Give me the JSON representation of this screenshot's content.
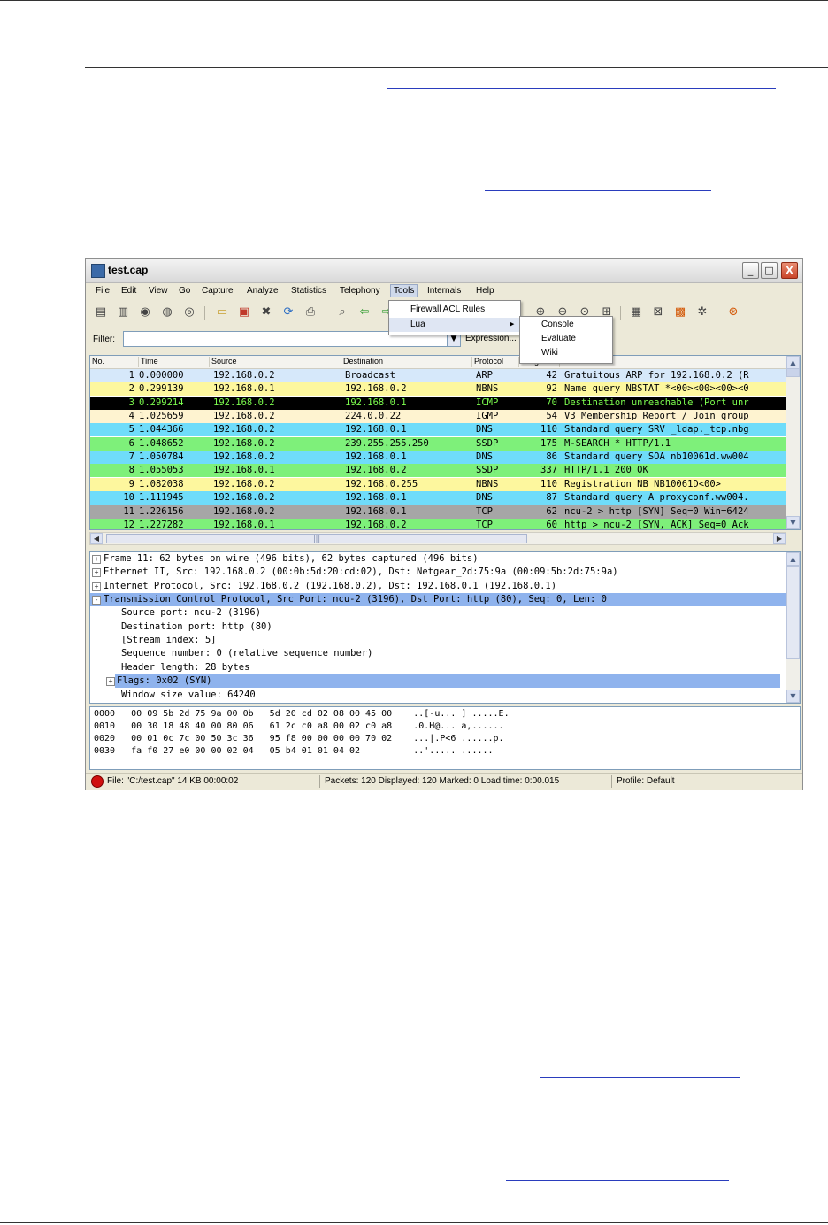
{
  "window": {
    "title": "test.cap",
    "minimize": "_",
    "maximize": "□",
    "close": "X"
  },
  "menubar": [
    "File",
    "Edit",
    "View",
    "Go",
    "Capture",
    "Analyze",
    "Statistics",
    "Telephony",
    "Tools",
    "Internals",
    "Help"
  ],
  "tools_menu": [
    "Firewall ACL Rules",
    "Lua"
  ],
  "lua_submenu": [
    "Console",
    "Evaluate",
    "Wiki"
  ],
  "filter": {
    "label": "Filter:",
    "value": "",
    "expression_button": "Expression..."
  },
  "packet_list": {
    "columns": [
      "No.",
      "Time",
      "Source",
      "Destination",
      "Protocol",
      "Length",
      "Info"
    ],
    "rows": [
      {
        "no": "1",
        "time": "0.000000",
        "src": "192.168.0.2",
        "dst": "Broadcast",
        "proto": "ARP",
        "len": "42",
        "info": "Gratuitous ARP for 192.168.0.2 (R",
        "bg": "#d6e8fa",
        "fg": "#000000"
      },
      {
        "no": "2",
        "time": "0.299139",
        "src": "192.168.0.1",
        "dst": "192.168.0.2",
        "proto": "NBNS",
        "len": "92",
        "info": "Name query NBSTAT *<00><00><00><0",
        "bg": "#fdf79e",
        "fg": "#000000"
      },
      {
        "no": "3",
        "time": "0.299214",
        "src": "192.168.0.2",
        "dst": "192.168.0.1",
        "proto": "ICMP",
        "len": "70",
        "info": "Destination unreachable (Port unr",
        "bg": "#000000",
        "fg": "#7cfc4e"
      },
      {
        "no": "4",
        "time": "1.025659",
        "src": "192.168.0.2",
        "dst": "224.0.0.22",
        "proto": "IGMP",
        "len": "54",
        "info": "V3 Membership Report / Join group",
        "bg": "#fef3d0",
        "fg": "#000000"
      },
      {
        "no": "5",
        "time": "1.044366",
        "src": "192.168.0.2",
        "dst": "192.168.0.1",
        "proto": "DNS",
        "len": "110",
        "info": "Standard query SRV _ldap._tcp.nbg",
        "bg": "#6fdcfa",
        "fg": "#000000"
      },
      {
        "no": "6",
        "time": "1.048652",
        "src": "192.168.0.2",
        "dst": "239.255.255.250",
        "proto": "SSDP",
        "len": "175",
        "info": "M-SEARCH * HTTP/1.1",
        "bg": "#7ef07a",
        "fg": "#000000"
      },
      {
        "no": "7",
        "time": "1.050784",
        "src": "192.168.0.2",
        "dst": "192.168.0.1",
        "proto": "DNS",
        "len": "86",
        "info": "Standard query SOA nb10061d.ww004",
        "bg": "#6fdcfa",
        "fg": "#000000"
      },
      {
        "no": "8",
        "time": "1.055053",
        "src": "192.168.0.1",
        "dst": "192.168.0.2",
        "proto": "SSDP",
        "len": "337",
        "info": "HTTP/1.1 200 OK",
        "bg": "#7ef07a",
        "fg": "#000000"
      },
      {
        "no": "9",
        "time": "1.082038",
        "src": "192.168.0.2",
        "dst": "192.168.0.255",
        "proto": "NBNS",
        "len": "110",
        "info": "Registration NB NB10061D<00>",
        "bg": "#fdf79e",
        "fg": "#000000"
      },
      {
        "no": "10",
        "time": "1.111945",
        "src": "192.168.0.2",
        "dst": "192.168.0.1",
        "proto": "DNS",
        "len": "87",
        "info": "Standard query A proxyconf.ww004.",
        "bg": "#6fdcfa",
        "fg": "#000000"
      },
      {
        "no": "11",
        "time": "1.226156",
        "src": "192.168.0.2",
        "dst": "192.168.0.1",
        "proto": "TCP",
        "len": "62",
        "info": "ncu-2 > http [SYN] Seq=0 Win=6424",
        "bg": "#a6a6a6",
        "fg": "#000000"
      },
      {
        "no": "12",
        "time": "1.227282",
        "src": "192.168.0.1",
        "dst": "192.168.0.2",
        "proto": "TCP",
        "len": "60",
        "info": "http > ncu-2 [SYN, ACK] Seq=0 Ack",
        "bg": "#7ef07a",
        "fg": "#000000"
      }
    ]
  },
  "details": [
    {
      "exp": "+",
      "indent": 0,
      "text": "Frame 11: 62 bytes on wire (496 bits), 62 bytes captured (496 bits)",
      "sel": false
    },
    {
      "exp": "+",
      "indent": 0,
      "text": "Ethernet II, Src: 192.168.0.2 (00:0b:5d:20:cd:02), Dst: Netgear_2d:75:9a (00:09:5b:2d:75:9a)",
      "sel": false
    },
    {
      "exp": "+",
      "indent": 0,
      "text": "Internet Protocol, Src: 192.168.0.2 (192.168.0.2), Dst: 192.168.0.1 (192.168.0.1)",
      "sel": false
    },
    {
      "exp": "-",
      "indent": 0,
      "text": "Transmission Control Protocol, Src Port: ncu-2 (3196), Dst Port: http (80), Seq: 0, Len: 0",
      "sel": true
    },
    {
      "exp": "",
      "indent": 1,
      "text": "Source port: ncu-2 (3196)",
      "sel": false
    },
    {
      "exp": "",
      "indent": 1,
      "text": "Destination port: http (80)",
      "sel": false
    },
    {
      "exp": "",
      "indent": 1,
      "text": "[Stream index: 5]",
      "sel": false
    },
    {
      "exp": "",
      "indent": 1,
      "text": "Sequence number: 0    (relative sequence number)",
      "sel": false
    },
    {
      "exp": "",
      "indent": 1,
      "text": "Header length: 28 bytes",
      "sel": false
    },
    {
      "exp": "+",
      "indent": 1,
      "text": "Flags: 0x02 (SYN)",
      "sel": true
    },
    {
      "exp": "",
      "indent": 1,
      "text": "Window size value: 64240",
      "sel": false
    }
  ],
  "bytes": [
    "0000   00 09 5b 2d 75 9a 00 0b   5d 20 cd 02 08 00 45 00    ..[-u... ] .....E.",
    "0010   00 30 18 48 40 00 80 06   61 2c c0 a8 00 02 c0 a8    .0.H@... a,......",
    "0020   00 01 0c 7c 00 50 3c 36   95 f8 00 00 00 00 70 02    ...|.P<6 ......p.",
    "0030   fa f0 27 e0 00 00 02 04   05 b4 01 01 04 02          ..'..... ......"
  ],
  "status": {
    "file": "File: \"C:/test.cap\" 14 KB 00:00:02",
    "packets": "Packets: 120 Displayed: 120 Marked: 0 Load time: 0:00.015",
    "profile": "Profile: Default"
  }
}
